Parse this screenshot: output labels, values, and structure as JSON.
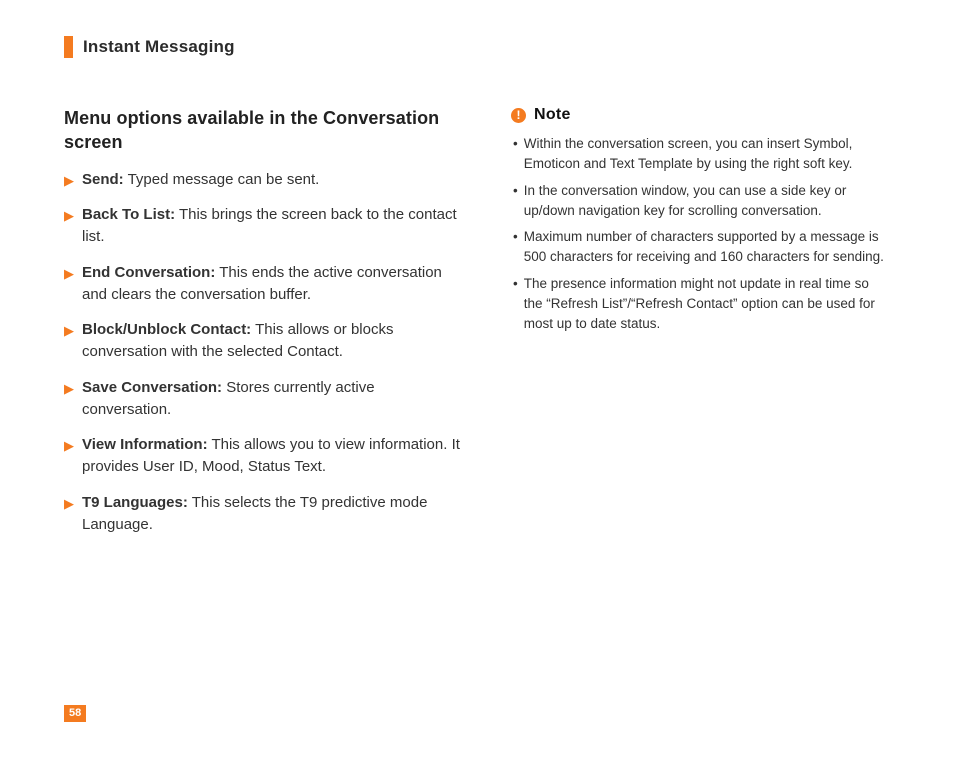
{
  "header": {
    "title": "Instant Messaging"
  },
  "page_number": "58",
  "left": {
    "heading": "Menu options available in the Conversation screen",
    "items": [
      {
        "term": "Send:",
        "desc": " Typed message can be sent."
      },
      {
        "term": "Back To List:",
        "desc": " This brings the screen back to the contact list."
      },
      {
        "term": "End Conversation:",
        "desc": " This ends the active conversation and clears the conversation buffer."
      },
      {
        "term": "Block/Unblock Contact:",
        "desc": " This allows or blocks conversation with the selected Contact."
      },
      {
        "term": "Save Conversation:",
        "desc": " Stores currently active conversation."
      },
      {
        "term": "View Information:",
        "desc": " This allows you to view information. It provides User ID, Mood, Status Text."
      },
      {
        "term": "T9 Languages:",
        "desc": " This selects the T9 predictive mode Language."
      }
    ]
  },
  "right": {
    "note_icon_glyph": "!",
    "note_title": "Note",
    "notes": [
      "Within the conversation screen, you can insert Symbol, Emoticon and Text Template by using the right soft key.",
      "In the conversation window, you can use a side key or up/down navigation key for scrolling conversation.",
      "Maximum number of characters supported by a message is 500 characters for receiving and 160 characters for sending.",
      "The presence information might not update in real time so the “Refresh List”/“Refresh Contact” option can be used for most up to date status."
    ]
  }
}
